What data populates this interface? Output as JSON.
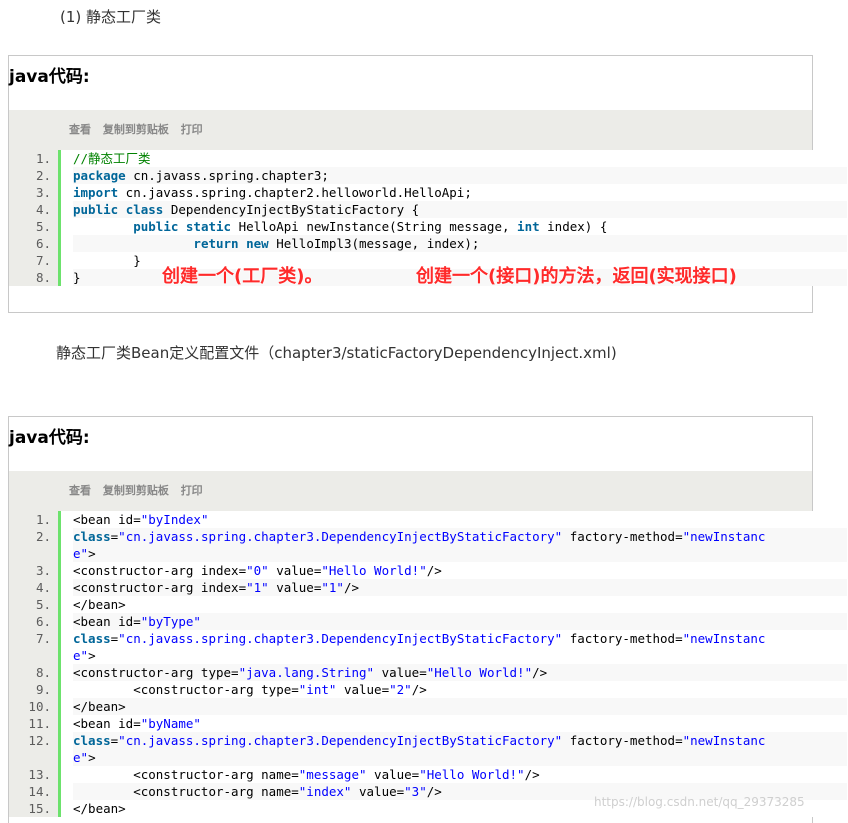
{
  "heading1": "(1) 静态工厂类",
  "heading2": "静态工厂类Bean定义配置文件（chapter3/staticFactoryDependencyInject.xml)",
  "block1": {
    "title": "java代码:",
    "toolbar": [
      "查看",
      "复制到剪贴板",
      "打印"
    ],
    "lines": [
      {
        "num": "1.",
        "html": "<span class=\"cm\">//静态工厂类</span>"
      },
      {
        "num": "2.",
        "html": "<span class=\"kw\">package</span> cn.javass.spring.chapter3;"
      },
      {
        "num": "3.",
        "html": "<span class=\"kw\">import</span> cn.javass.spring.chapter2.helloworld.HelloApi;"
      },
      {
        "num": "4.",
        "html": "<span class=\"kw\">public</span> <span class=\"kw\">class</span> DependencyInjectByStaticFactory {"
      },
      {
        "num": "5.",
        "html": "        <span class=\"kw\">public</span> <span class=\"kw\">static</span> HelloApi newInstance(String message, <span class=\"kw\">int</span> index) {"
      },
      {
        "num": "6.",
        "html": "                <span class=\"kw\">return</span> <span class=\"kw\">new</span> HelloImpl3(message, index);"
      },
      {
        "num": "7.",
        "html": "        }"
      },
      {
        "num": "8.",
        "html": "}"
      }
    ]
  },
  "annotations": {
    "a1": "创建一个(工厂类)。",
    "a2": "创建一个(接口)的方法，返回(实现接口)"
  },
  "block2": {
    "title": "java代码:",
    "toolbar": [
      "查看",
      "复制到剪贴板",
      "打印"
    ],
    "lines": [
      {
        "num": "1.",
        "html": "&lt;bean id=<span class=\"str\">\"byIndex\"</span>"
      },
      {
        "num": "2.",
        "html": "<span class=\"kw\">class</span>=<span class=\"str\">\"cn.javass.spring.chapter3.DependencyInjectByStaticFactory\"</span> factory-method=<span class=\"str\">\"newInstanc</span>"
      },
      {
        "num": "",
        "html": "<span class=\"str\">e\"</span>&gt;"
      },
      {
        "num": "3.",
        "html": "&lt;constructor-arg index=<span class=\"str\">\"0\"</span> value=<span class=\"str\">\"Hello World!\"</span>/&gt;"
      },
      {
        "num": "4.",
        "html": "&lt;constructor-arg index=<span class=\"str\">\"1\"</span> value=<span class=\"str\">\"1\"</span>/&gt;"
      },
      {
        "num": "5.",
        "html": "&lt;/bean&gt;"
      },
      {
        "num": "6.",
        "html": "&lt;bean id=<span class=\"str\">\"byType\"</span>"
      },
      {
        "num": "7.",
        "html": "<span class=\"kw\">class</span>=<span class=\"str\">\"cn.javass.spring.chapter3.DependencyInjectByStaticFactory\"</span> factory-method=<span class=\"str\">\"newInstanc</span>"
      },
      {
        "num": "",
        "html": "<span class=\"str\">e\"</span>&gt;"
      },
      {
        "num": "8.",
        "html": "&lt;constructor-arg type=<span class=\"str\">\"java.lang.String\"</span> value=<span class=\"str\">\"Hello World!\"</span>/&gt;"
      },
      {
        "num": "9.",
        "html": "        &lt;constructor-arg type=<span class=\"str\">\"int\"</span> value=<span class=\"str\">\"2\"</span>/&gt;"
      },
      {
        "num": "10.",
        "html": "&lt;/bean&gt;"
      },
      {
        "num": "11.",
        "html": "&lt;bean id=<span class=\"str\">\"byName\"</span>"
      },
      {
        "num": "12.",
        "html": "<span class=\"kw\">class</span>=<span class=\"str\">\"cn.javass.spring.chapter3.DependencyInjectByStaticFactory\"</span> factory-method=<span class=\"str\">\"newInstanc</span>"
      },
      {
        "num": "",
        "html": "<span class=\"str\">e\"</span>&gt;"
      },
      {
        "num": "13.",
        "html": "        &lt;constructor-arg name=<span class=\"str\">\"message\"</span> value=<span class=\"str\">\"Hello World!\"</span>/&gt;"
      },
      {
        "num": "14.",
        "html": "        &lt;constructor-arg name=<span class=\"str\">\"index\"</span> value=<span class=\"str\">\"3\"</span>/&gt;"
      },
      {
        "num": "15.",
        "html": "&lt;/bean&gt;"
      }
    ]
  },
  "watermark": "https://blog.csdn.net/qq_29373285"
}
